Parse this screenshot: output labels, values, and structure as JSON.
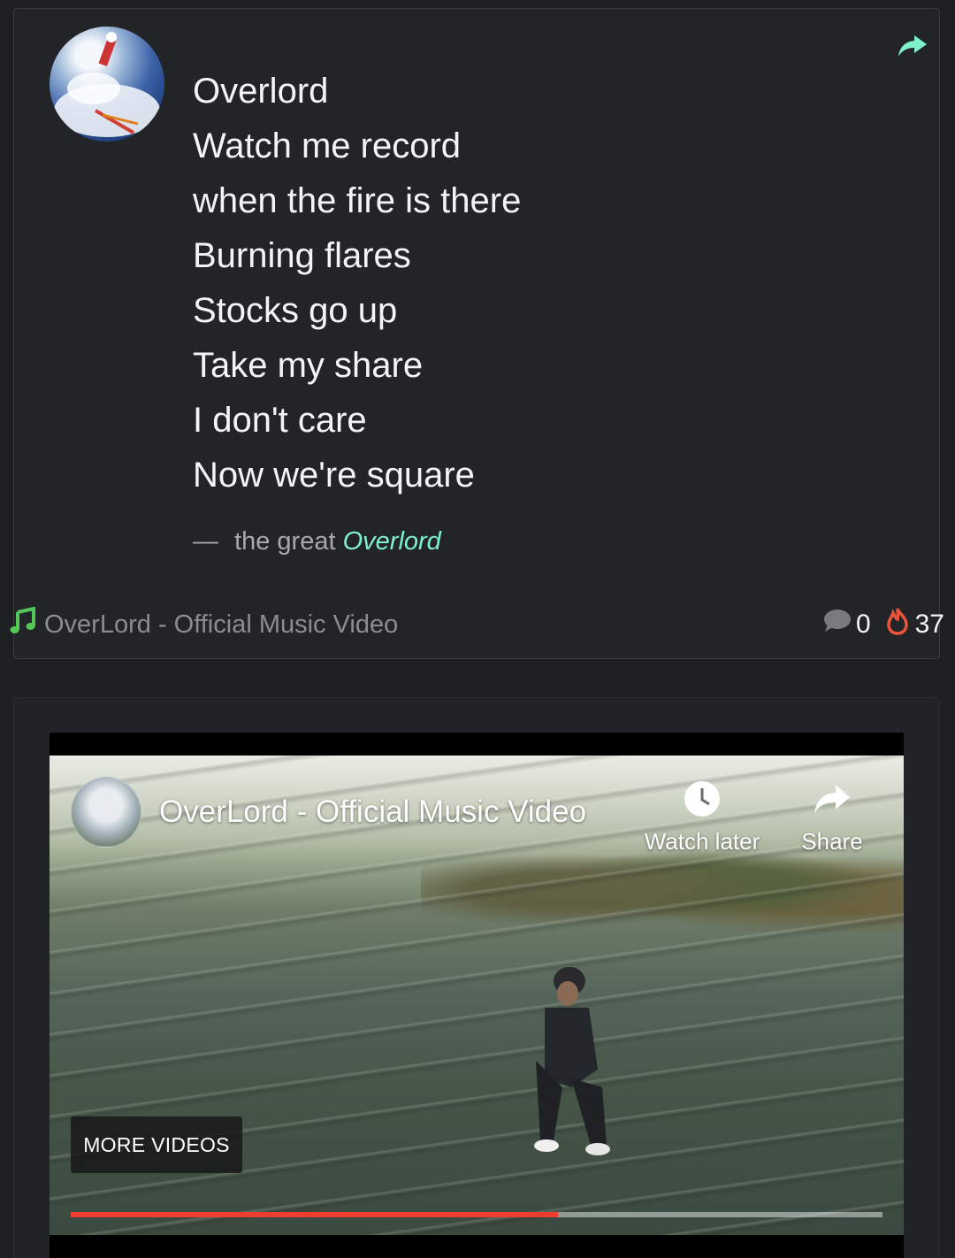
{
  "post": {
    "poem_lines": [
      "Overlord",
      "Watch me record",
      "when the fire is there",
      "Burning flares",
      "Stocks go up",
      "Take my share",
      "I don't care",
      "Now we're square"
    ],
    "attribution": {
      "dash": "—",
      "prefix": "the great",
      "author": "Overlord"
    },
    "track_link": "OverLord - Official Music Video",
    "comment_count": "0",
    "fire_count": "37",
    "icons": {
      "share": "share-arrow-icon",
      "music": "music-note-icon",
      "comment": "comment-bubble-icon",
      "fire": "flame-icon"
    },
    "colors": {
      "accent": "#7ff0c9",
      "music_icon": "#55c65a",
      "fire_icon": "#e8553a"
    }
  },
  "video": {
    "title": "OverLord - Official Music Video",
    "watch_later_label": "Watch later",
    "share_label": "Share",
    "more_videos_label": "MORE VIDEOS",
    "progress_fraction": 0.6,
    "progress_color": "#f03c2e"
  }
}
